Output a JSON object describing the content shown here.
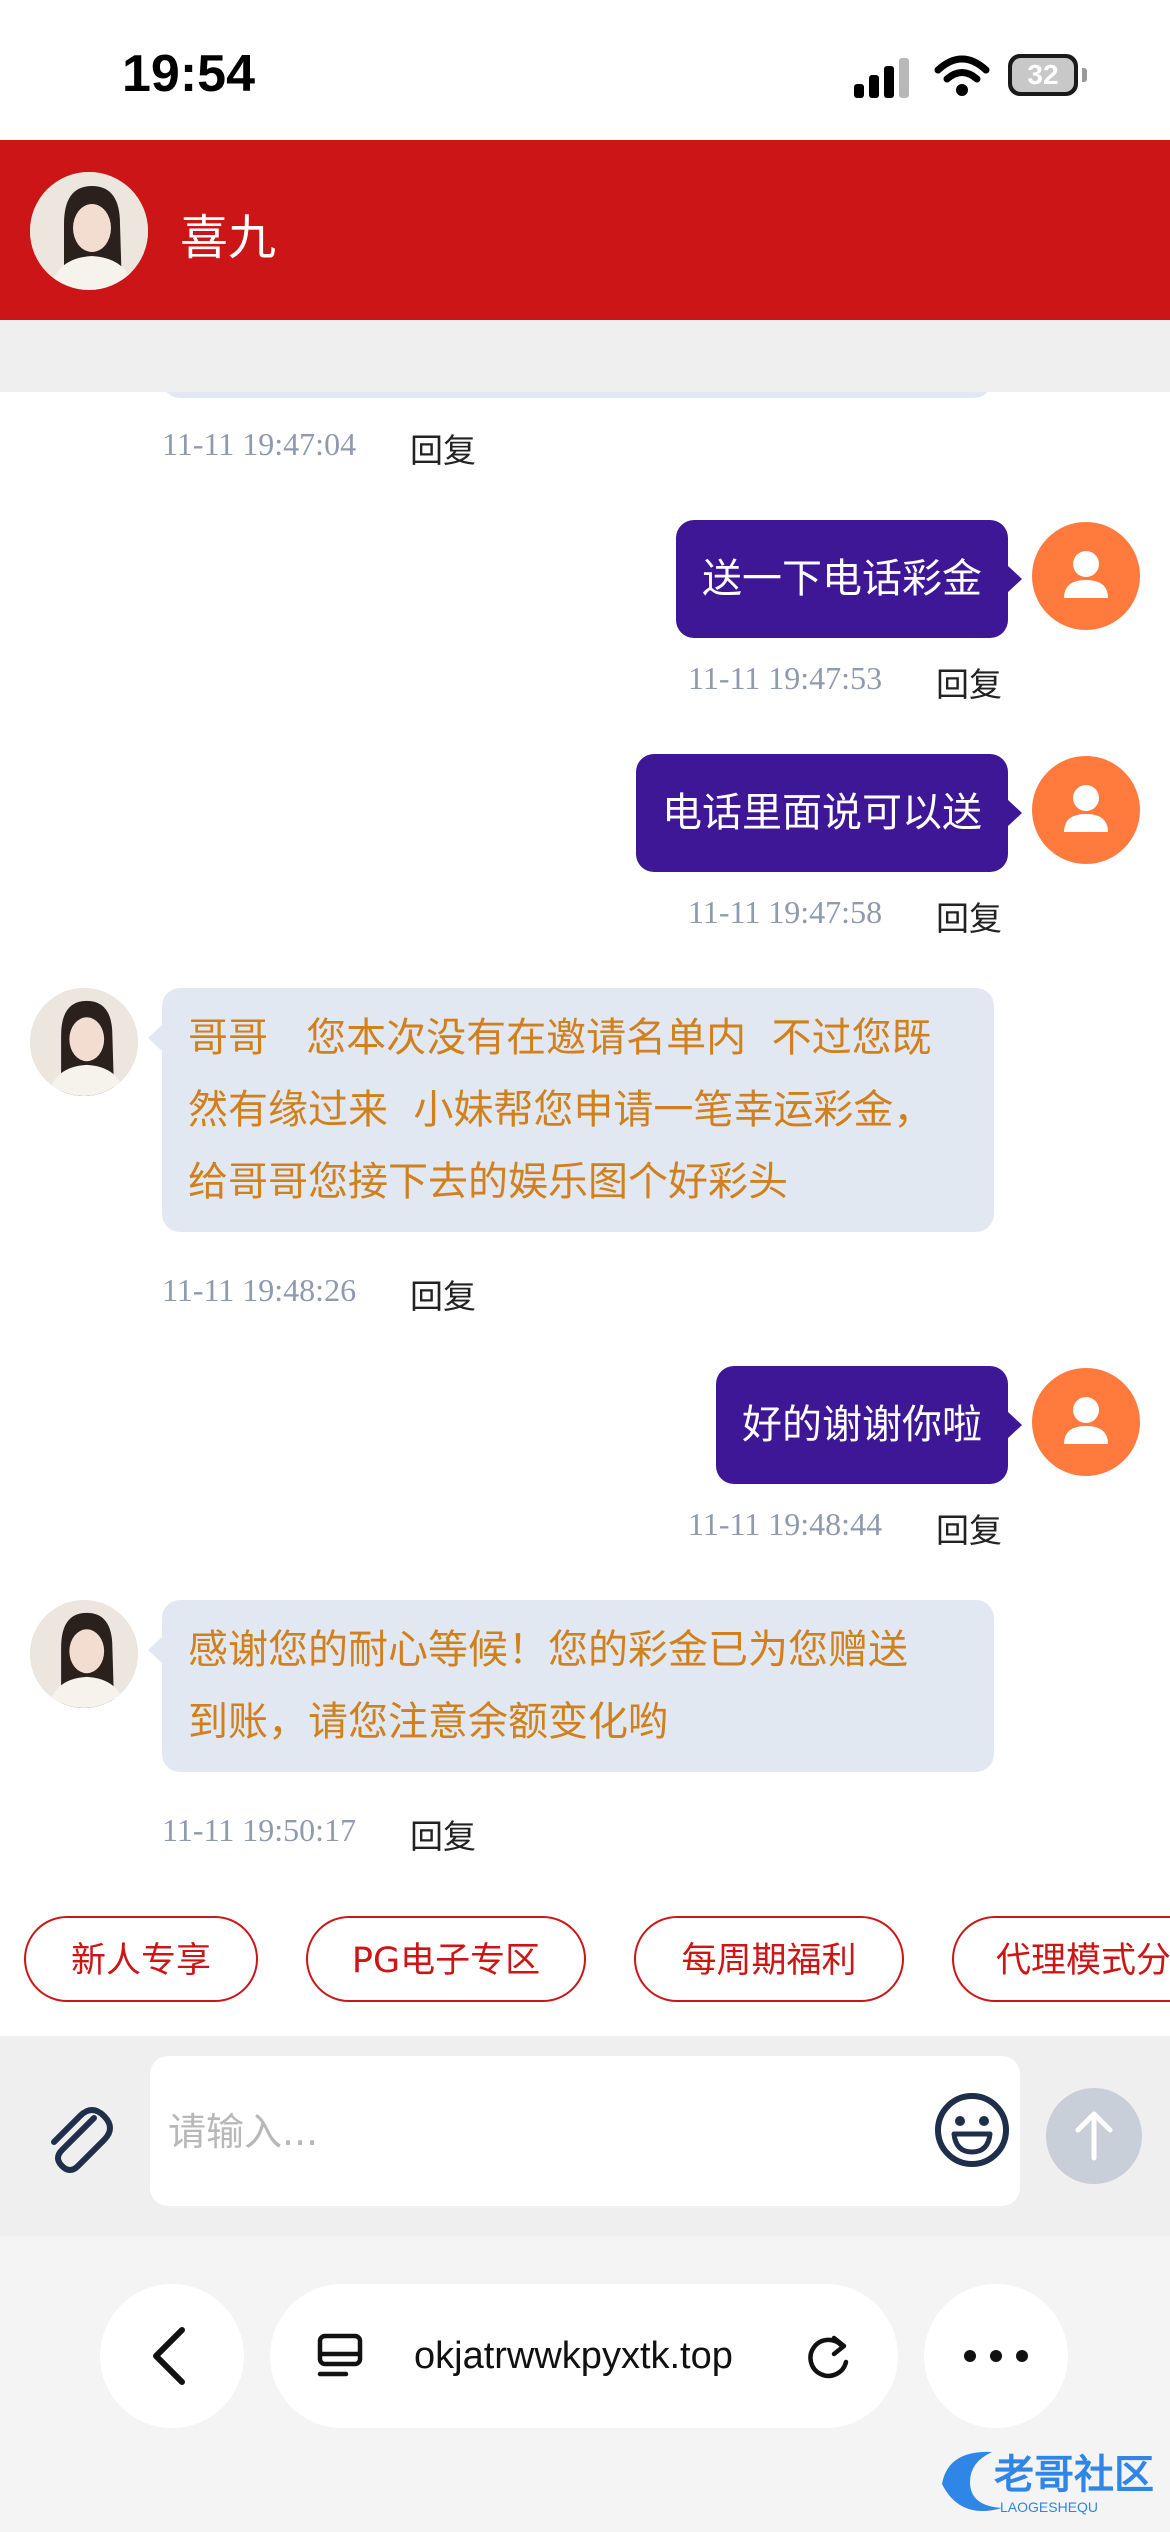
{
  "status_bar": {
    "time": "19:54",
    "battery": "32"
  },
  "header": {
    "contact_name": "喜九"
  },
  "messages": [
    {
      "side": "left",
      "time": "11-11 19:47:04",
      "reply": "回复"
    },
    {
      "side": "right",
      "text": "送一下电话彩金",
      "time": "11-11 19:47:53",
      "reply": "回复"
    },
    {
      "side": "right",
      "text": "电话里面说可以送",
      "time": "11-11 19:47:58",
      "reply": "回复"
    },
    {
      "side": "left",
      "lines": [
        "哥哥   您本次没有在邀请名单内  不过您既",
        "然有缘过来  小妹帮您申请一笔幸运彩金，",
        "给哥哥您接下去的娱乐图个好彩头"
      ],
      "time": "11-11 19:48:26",
      "reply": "回复"
    },
    {
      "side": "right",
      "text": "好的谢谢你啦",
      "time": "11-11 19:48:44",
      "reply": "回复"
    },
    {
      "side": "left",
      "lines": [
        "感谢您的耐心等候！您的彩金已为您赠送",
        "到账，请您注意余额变化哟"
      ],
      "time": "11-11 19:50:17",
      "reply": "回复"
    }
  ],
  "quick_replies": [
    "新人专享",
    "PG电子专区",
    "每周期福利",
    "代理模式分"
  ],
  "composer": {
    "placeholder": "请输入..."
  },
  "browser": {
    "url": "okjatrwwkpyxtk.top"
  },
  "watermark": {
    "text": "老哥社区",
    "subtext": "LAOGESHEQU"
  },
  "colors": {
    "header": "#cc1516",
    "user_bubble": "#3d1796",
    "agent_text": "#d0801d",
    "agent_bubble": "#e2e8f2",
    "user_avatar": "#ff7a3c"
  },
  "icons": [
    "signal-icon",
    "wifi-icon",
    "battery-icon",
    "paperclip-icon",
    "emoji-icon",
    "arrow-up-icon",
    "back-chevron-icon",
    "tabs-icon",
    "reload-icon",
    "more-icon",
    "person-icon"
  ]
}
